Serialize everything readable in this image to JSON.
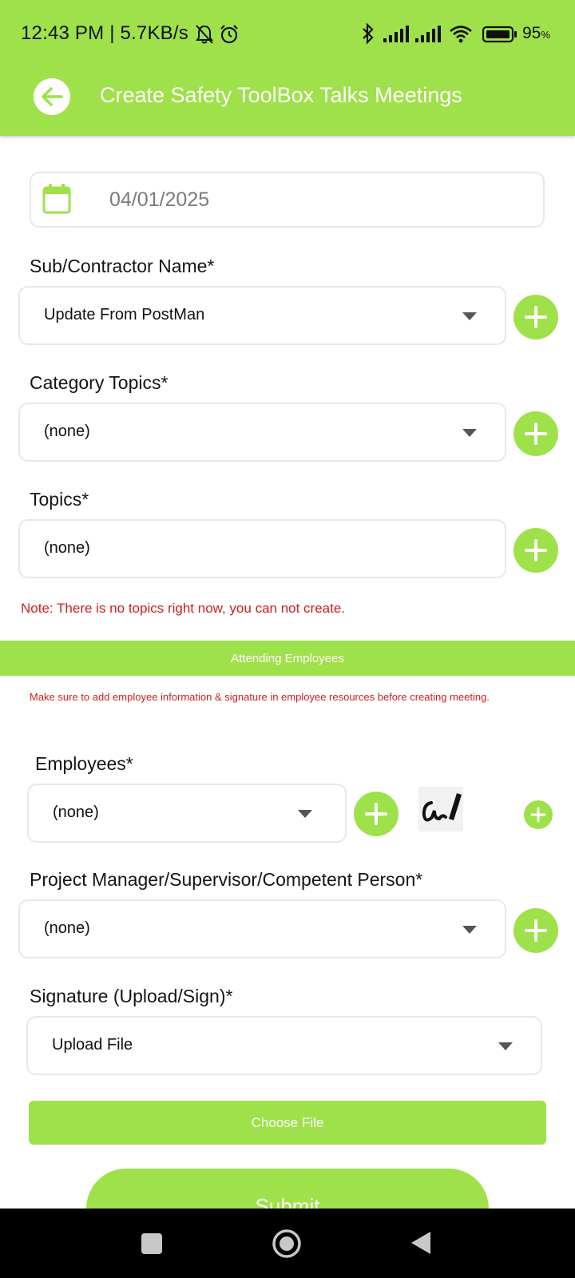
{
  "status_bar": {
    "time_speed": "12:43 PM | 5.7KB/s",
    "battery": "95",
    "battery_unit": "%",
    "icons": [
      "notifications-off-icon",
      "alarm-icon",
      "bluetooth-icon",
      "signal-icon",
      "signal-icon",
      "wifi-icon",
      "battery-icon"
    ]
  },
  "app_bar": {
    "title": "Create Safety ToolBox Talks Meetings",
    "back_icon": "back-arrow-icon"
  },
  "form": {
    "date": "04/01/2025",
    "sub_contractor": {
      "label": "Sub/Contractor Name*",
      "value": "Update From PostMan"
    },
    "category_topics": {
      "label": "Category Topics*",
      "value": "(none)"
    },
    "topics": {
      "label": "Topics*",
      "value": "(none)"
    },
    "topics_note": "Note: There is no topics right now, you can not create.",
    "attending_employees_header": "Attending Employees",
    "employees_note": "Make sure to add employee information & signature in employee resources before creating meeting.",
    "employees": {
      "label": "Employees*",
      "value": "(none)"
    },
    "project_manager": {
      "label": "Project Manager/Supervisor/Competent Person*",
      "value": "(none)"
    },
    "signature": {
      "label": "Signature (Upload/Sign)*",
      "value": "Upload File"
    },
    "choose_file_label": "Choose File",
    "submit_label": "Submit"
  },
  "colors": {
    "accent": "#9fe14a",
    "warning_text": "#cc1f1f",
    "field_border": "#e6e6f3"
  }
}
